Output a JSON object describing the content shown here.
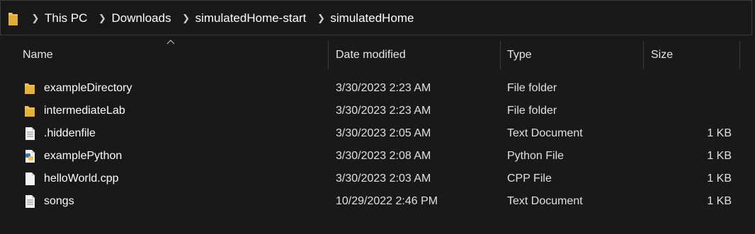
{
  "breadcrumb": {
    "items": [
      "This PC",
      "Downloads",
      "simulatedHome-start",
      "simulatedHome"
    ]
  },
  "columns": {
    "name": "Name",
    "date": "Date modified",
    "type": "Type",
    "size": "Size"
  },
  "files": [
    {
      "name": "exampleDirectory",
      "date": "3/30/2023 2:23 AM",
      "type": "File folder",
      "size": "",
      "icon": "folder-icon"
    },
    {
      "name": "intermediateLab",
      "date": "3/30/2023 2:23 AM",
      "type": "File folder",
      "size": "",
      "icon": "folder-icon"
    },
    {
      "name": ".hiddenfile",
      "date": "3/30/2023 2:05 AM",
      "type": "Text Document",
      "size": "1 KB",
      "icon": "text-document-icon"
    },
    {
      "name": "examplePython",
      "date": "3/30/2023 2:08 AM",
      "type": "Python File",
      "size": "1 KB",
      "icon": "python-file-icon"
    },
    {
      "name": "helloWorld.cpp",
      "date": "3/30/2023 2:03 AM",
      "type": "CPP File",
      "size": "1 KB",
      "icon": "file-icon"
    },
    {
      "name": "songs",
      "date": "10/29/2022 2:46 PM",
      "type": "Text Document",
      "size": "1 KB",
      "icon": "text-document-icon"
    }
  ],
  "colors": {
    "background": "#191919",
    "folder": "#f3c24c",
    "separator": "#3c3c3c"
  }
}
